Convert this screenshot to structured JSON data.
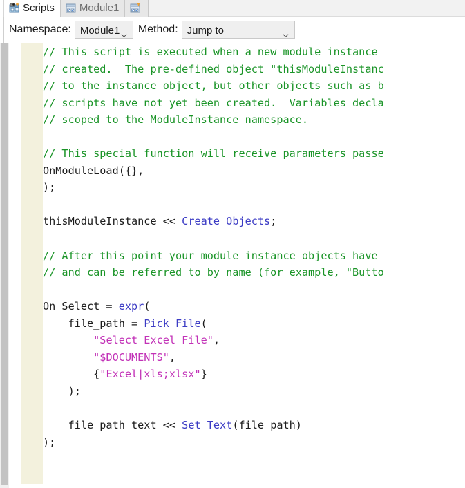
{
  "window": {
    "title": "Scripts"
  },
  "tabs": [
    {
      "label": "Scripts",
      "icon": "scripts-window-icon",
      "active": true
    },
    {
      "label": "Module1",
      "icon": "module-window-icon",
      "active": false
    },
    {
      "label": "",
      "icon": "module-window-icon",
      "active": false
    }
  ],
  "toolbar": {
    "namespace_label": "Namespace:",
    "namespace_value": "Module1",
    "namespace_options": [
      "Module1"
    ],
    "method_label": "Method:",
    "method_value": "Jump to",
    "method_options": [
      "Jump to"
    ],
    "dropdown_icon": "chevron-down-icon"
  },
  "editor": {
    "gutter_color": "#f3f1dd",
    "comment_color": "#1a9427",
    "keyword_color": "#3b3bc4",
    "string_color": "#c231b7",
    "plain_color": "#1c1c1c",
    "lines": [
      [
        {
          "t": "// This script is executed when a new module instance ",
          "c": "cm"
        }
      ],
      [
        {
          "t": "// created.  The pre-defined object \"thisModuleInstanc",
          "c": "cm"
        }
      ],
      [
        {
          "t": "// to the instance object, but other objects such as b",
          "c": "cm"
        }
      ],
      [
        {
          "t": "// scripts have not yet been created.  Variables decla",
          "c": "cm"
        }
      ],
      [
        {
          "t": "// scoped to the ModuleInstance namespace.",
          "c": "cm"
        }
      ],
      [
        {
          "t": "",
          "c": "pl"
        }
      ],
      [
        {
          "t": "// This special function will receive parameters passe",
          "c": "cm"
        }
      ],
      [
        {
          "t": "OnModuleLoad({},",
          "c": "pl"
        }
      ],
      [
        {
          "t": ");",
          "c": "pl"
        }
      ],
      [
        {
          "t": "",
          "c": "pl"
        }
      ],
      [
        {
          "t": "thisModuleInstance << ",
          "c": "pl"
        },
        {
          "t": "Create Objects",
          "c": "kw"
        },
        {
          "t": ";",
          "c": "pl"
        }
      ],
      [
        {
          "t": "",
          "c": "pl"
        }
      ],
      [
        {
          "t": "// After this point your module instance objects have ",
          "c": "cm"
        }
      ],
      [
        {
          "t": "// and can be referred to by name (for example, \"Butto",
          "c": "cm"
        }
      ],
      [
        {
          "t": "",
          "c": "pl"
        }
      ],
      [
        {
          "t": "On Select = ",
          "c": "pl"
        },
        {
          "t": "expr",
          "c": "kw"
        },
        {
          "t": "(",
          "c": "pl"
        }
      ],
      [
        {
          "t": "    file_path = ",
          "c": "pl"
        },
        {
          "t": "Pick File",
          "c": "kw"
        },
        {
          "t": "(",
          "c": "pl"
        }
      ],
      [
        {
          "t": "        ",
          "c": "pl"
        },
        {
          "t": "\"Select Excel File\"",
          "c": "str"
        },
        {
          "t": ",",
          "c": "pl"
        }
      ],
      [
        {
          "t": "        ",
          "c": "pl"
        },
        {
          "t": "\"$DOCUMENTS\"",
          "c": "str"
        },
        {
          "t": ",",
          "c": "pl"
        }
      ],
      [
        {
          "t": "        {",
          "c": "pl"
        },
        {
          "t": "\"Excel|xls;xlsx\"",
          "c": "str"
        },
        {
          "t": "}",
          "c": "pl"
        }
      ],
      [
        {
          "t": "    );",
          "c": "pl"
        }
      ],
      [
        {
          "t": "",
          "c": "pl"
        }
      ],
      [
        {
          "t": "    file_path_text << ",
          "c": "pl"
        },
        {
          "t": "Set Text",
          "c": "kw"
        },
        {
          "t": "(file_path)",
          "c": "pl"
        }
      ],
      [
        {
          "t": ");",
          "c": "pl"
        }
      ]
    ]
  }
}
